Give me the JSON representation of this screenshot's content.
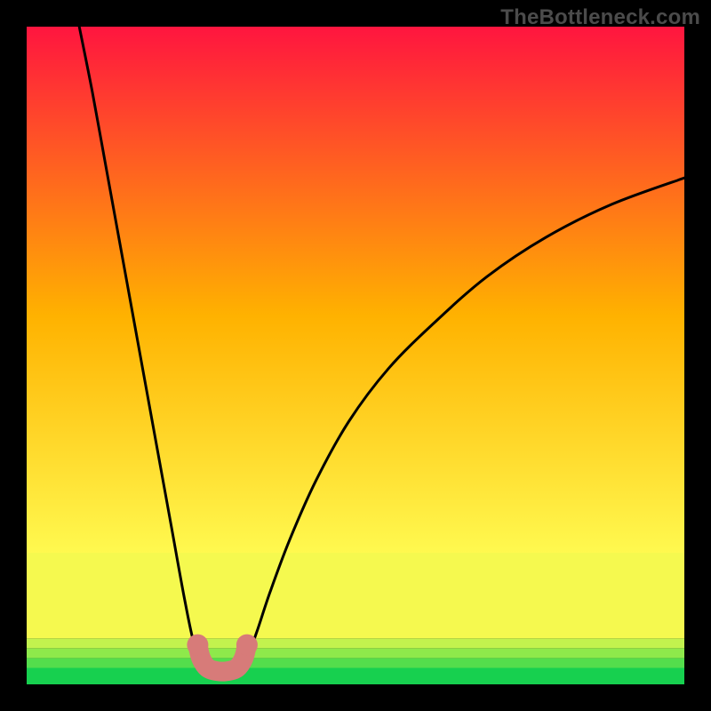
{
  "watermark": {
    "text": "TheBottleneck.com"
  },
  "chart_data": {
    "type": "line",
    "title": "",
    "xlabel": "",
    "ylabel": "",
    "xlim": [
      0,
      100
    ],
    "ylim": [
      0,
      100
    ],
    "series": [
      {
        "name": "curve-left",
        "x": [
          8,
          10,
          12,
          14,
          16,
          18,
          20,
          22,
          24,
          25.5,
          27,
          28.5
        ],
        "y": [
          100,
          90,
          79,
          68,
          57,
          46,
          35,
          24,
          13,
          6,
          3,
          2
        ]
      },
      {
        "name": "curve-right",
        "x": [
          32,
          33.5,
          35,
          37,
          40,
          44,
          49,
          55,
          62,
          70,
          79,
          89,
          100
        ],
        "y": [
          2,
          4,
          8,
          14,
          22,
          31,
          40,
          48,
          55,
          62,
          68,
          73,
          77
        ]
      },
      {
        "name": "optimal-marker",
        "x": [
          26,
          26.5,
          27.5,
          29,
          30.5,
          32,
          33,
          33.5
        ],
        "y": [
          6,
          4,
          2.5,
          2,
          2,
          2.5,
          4,
          6
        ]
      }
    ],
    "background_bands": [
      {
        "y0": 0,
        "y1": 2.5,
        "color": "#17d04f"
      },
      {
        "y0": 2.5,
        "y1": 4,
        "color": "#54dd4c"
      },
      {
        "y0": 4,
        "y1": 5.5,
        "color": "#8ee94b"
      },
      {
        "y0": 5.5,
        "y1": 7,
        "color": "#c2f24e"
      },
      {
        "y0": 7,
        "y1": 20,
        "color": "#f5f94f"
      },
      {
        "y0": 20,
        "y1": 100,
        "color": "gradient"
      }
    ],
    "gradient": {
      "top": "#ff153f",
      "mid": "#ffb200",
      "bottom": "#fff94f"
    },
    "marker_color": "#d77b79",
    "curve_color": "#000000"
  }
}
